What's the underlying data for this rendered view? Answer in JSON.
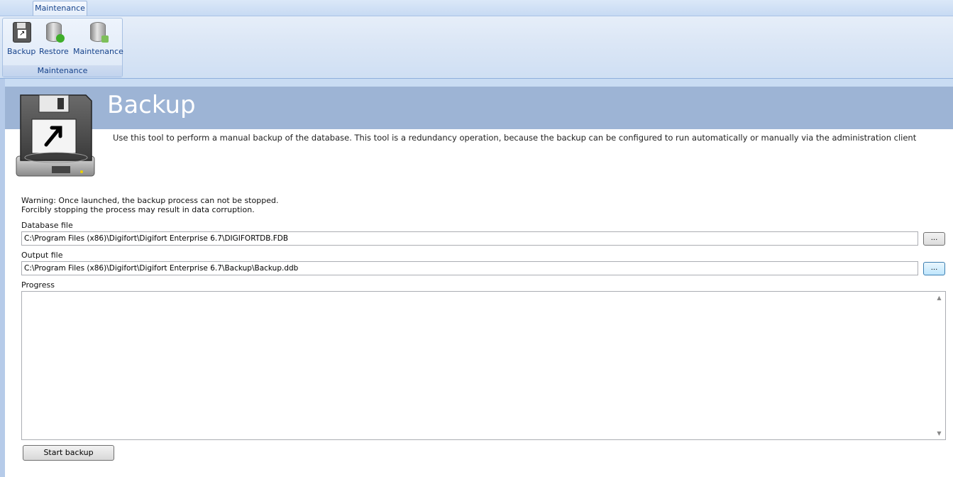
{
  "ribbon": {
    "tab_label": "Maintenance",
    "group_caption": "Maintenance",
    "buttons": [
      {
        "label": "Backup",
        "icon": "floppy-backup-icon"
      },
      {
        "label": "Restore",
        "icon": "database-restore-icon"
      },
      {
        "label": "Maintenance",
        "icon": "database-maintenance-icon"
      }
    ]
  },
  "main": {
    "title": "Backup",
    "description": "Use this tool to perform a manual backup of the database. This tool is a redundancy operation, because the backup can be configured to run automatically or manually via the administration client",
    "warning_line1": "Warning: Once launched, the backup process can not be stopped.",
    "warning_line2": "Forcibly stopping the process may result in data corruption.",
    "database_file": {
      "label": "Database file",
      "value": "C:\\Program Files (x86)\\Digifort\\Digifort Enterprise 6.7\\DIGIFORTDB.FDB",
      "browse_label": "..."
    },
    "output_file": {
      "label": "Output file",
      "value": "C:\\Program Files (x86)\\Digifort\\Digifort Enterprise 6.7\\Backup\\Backup.ddb",
      "browse_label": "..."
    },
    "progress_label": "Progress",
    "start_button": "Start backup"
  },
  "colors": {
    "header_band": "#9db4d5",
    "ribbon_text": "#15428b",
    "accent_green": "#3fae2a"
  }
}
